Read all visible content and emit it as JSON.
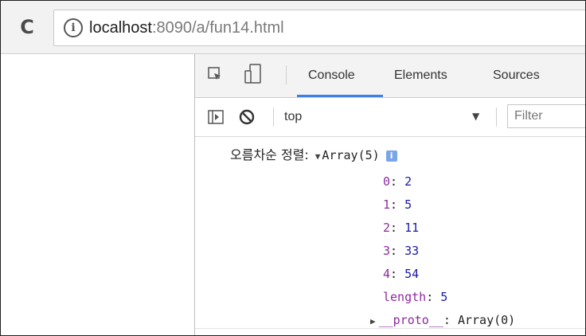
{
  "browser": {
    "url_host": "localhost",
    "url_path": ":8090/a/fun14.html"
  },
  "devtools": {
    "tabs": [
      {
        "label": "Console",
        "active": true
      },
      {
        "label": "Elements",
        "active": false
      },
      {
        "label": "Sources",
        "active": false
      }
    ],
    "context": "top",
    "filter_placeholder": "Filter",
    "accent_color": "#3f7fe8"
  },
  "console": {
    "log_label": "오름차순 정렬:",
    "summary": "Array(5)",
    "badge": "i",
    "items": [
      {
        "key": "0",
        "value": "2"
      },
      {
        "key": "1",
        "value": "5"
      },
      {
        "key": "2",
        "value": "11"
      },
      {
        "key": "3",
        "value": "33"
      },
      {
        "key": "4",
        "value": "54"
      },
      {
        "key": "length",
        "value": "5"
      }
    ],
    "proto_key": "__proto__",
    "proto_value": "Array(0)"
  },
  "icons": [
    "reload-icon",
    "info-icon",
    "inspect-icon",
    "device-icon",
    "sidebar-icon",
    "clear-icon"
  ]
}
